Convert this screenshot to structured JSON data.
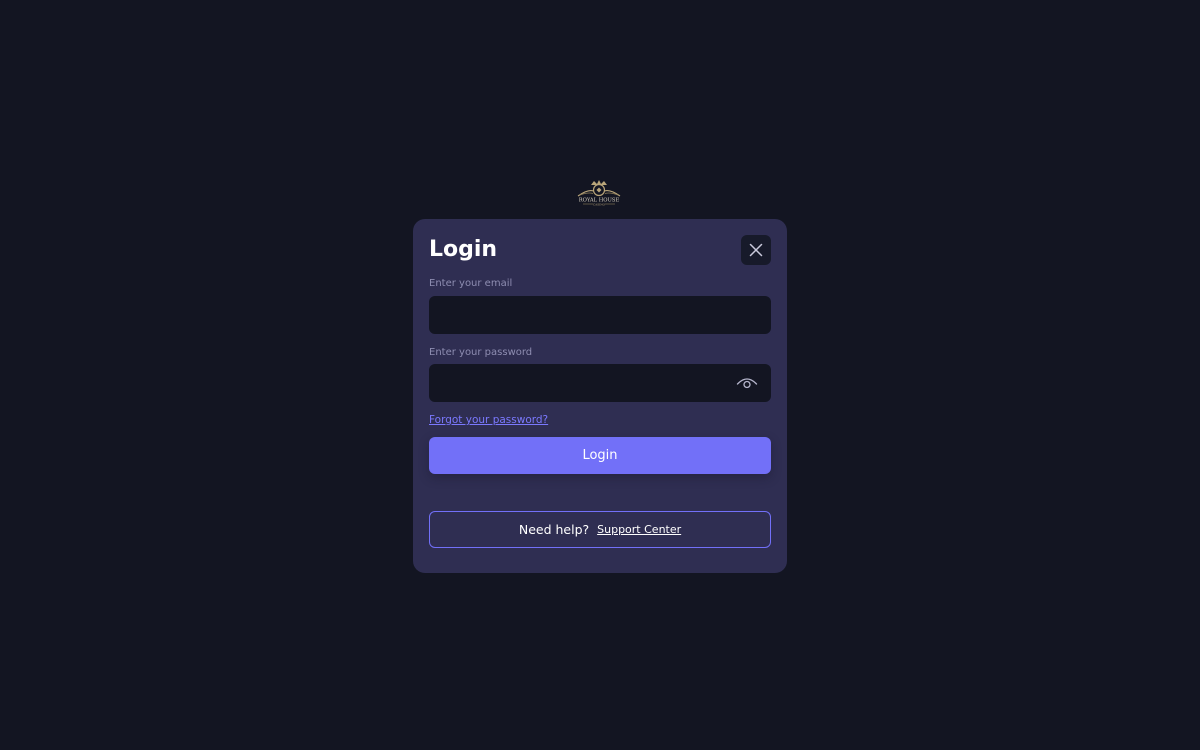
{
  "brand": {
    "logo_icon": "royal-house-casino-logo",
    "logo_text": "ROYAL HOUSE",
    "logo_subtext": "CASINO",
    "logo_color": "#b9a57a"
  },
  "modal": {
    "title": "Login",
    "close_icon": "close-icon",
    "email_label": "Enter your email",
    "email_value": "",
    "password_label": "Enter your password",
    "password_value": "",
    "eye_icon": "eye-icon",
    "forgot_link": "Forgot your password?",
    "login_button": "Login",
    "help_text": "Need help?",
    "support_link": "Support Center"
  },
  "colors": {
    "background": "#131522",
    "modal": "#2f2e52",
    "accent": "#7270f8",
    "link": "#7b79ff"
  }
}
